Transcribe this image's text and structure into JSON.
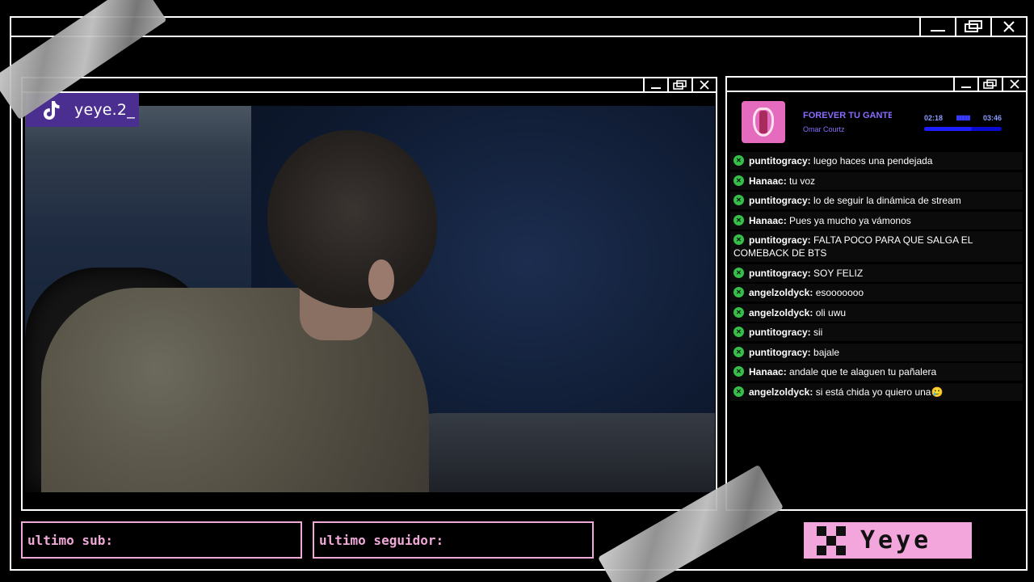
{
  "stream": {
    "channel_name": "yeye.2_",
    "brand_icon": "tiktok-logo"
  },
  "windows": {
    "outer": {
      "controls": [
        "minimize-icon",
        "restore-icon",
        "close-icon"
      ]
    },
    "video": {
      "controls": [
        "minimize-icon",
        "restore-icon",
        "close-icon"
      ]
    },
    "chat": {
      "controls": [
        "minimize-icon",
        "restore-icon",
        "close-icon"
      ]
    }
  },
  "music_player": {
    "title": "FOREVER TU GANTE",
    "artist": "Omar Courtz",
    "elapsed": "02:18",
    "duration": "03:46",
    "progress": 0.61,
    "accent_color": "#8b6bff"
  },
  "chat": {
    "messages": [
      {
        "user": "puntitogracy:",
        "text": "luego haces una pendejada"
      },
      {
        "user": "Hanaac:",
        "text": "tu voz"
      },
      {
        "user": "puntitogracy:",
        "text": "lo de seguir la dinámica de stream"
      },
      {
        "user": "Hanaac:",
        "text": "Pues ya mucho ya vámonos"
      },
      {
        "user": "puntitogracy:",
        "text": "FALTA POCO PARA QUE SALGA EL COMEBACK DE BTS"
      },
      {
        "user": "puntitogracy:",
        "text": "SOY FELIZ"
      },
      {
        "user": "angelzoldyck:",
        "text": "esooooooo"
      },
      {
        "user": "angelzoldyck:",
        "text": "oli uwu"
      },
      {
        "user": "puntitogracy:",
        "text": "sii"
      },
      {
        "user": "puntitogracy:",
        "text": "bajale"
      },
      {
        "user": "Hanaac:",
        "text": "andale que te alaguen tu pañalera"
      },
      {
        "user": "angelzoldyck:",
        "text": "si está chida yo quiero una🥲"
      }
    ]
  },
  "bottom": {
    "last_sub_label": "ultimo sub:",
    "last_follower_label": "ultimo seguidor:",
    "logo_text": "Yeye",
    "accent_color": "#f3a6dc"
  }
}
